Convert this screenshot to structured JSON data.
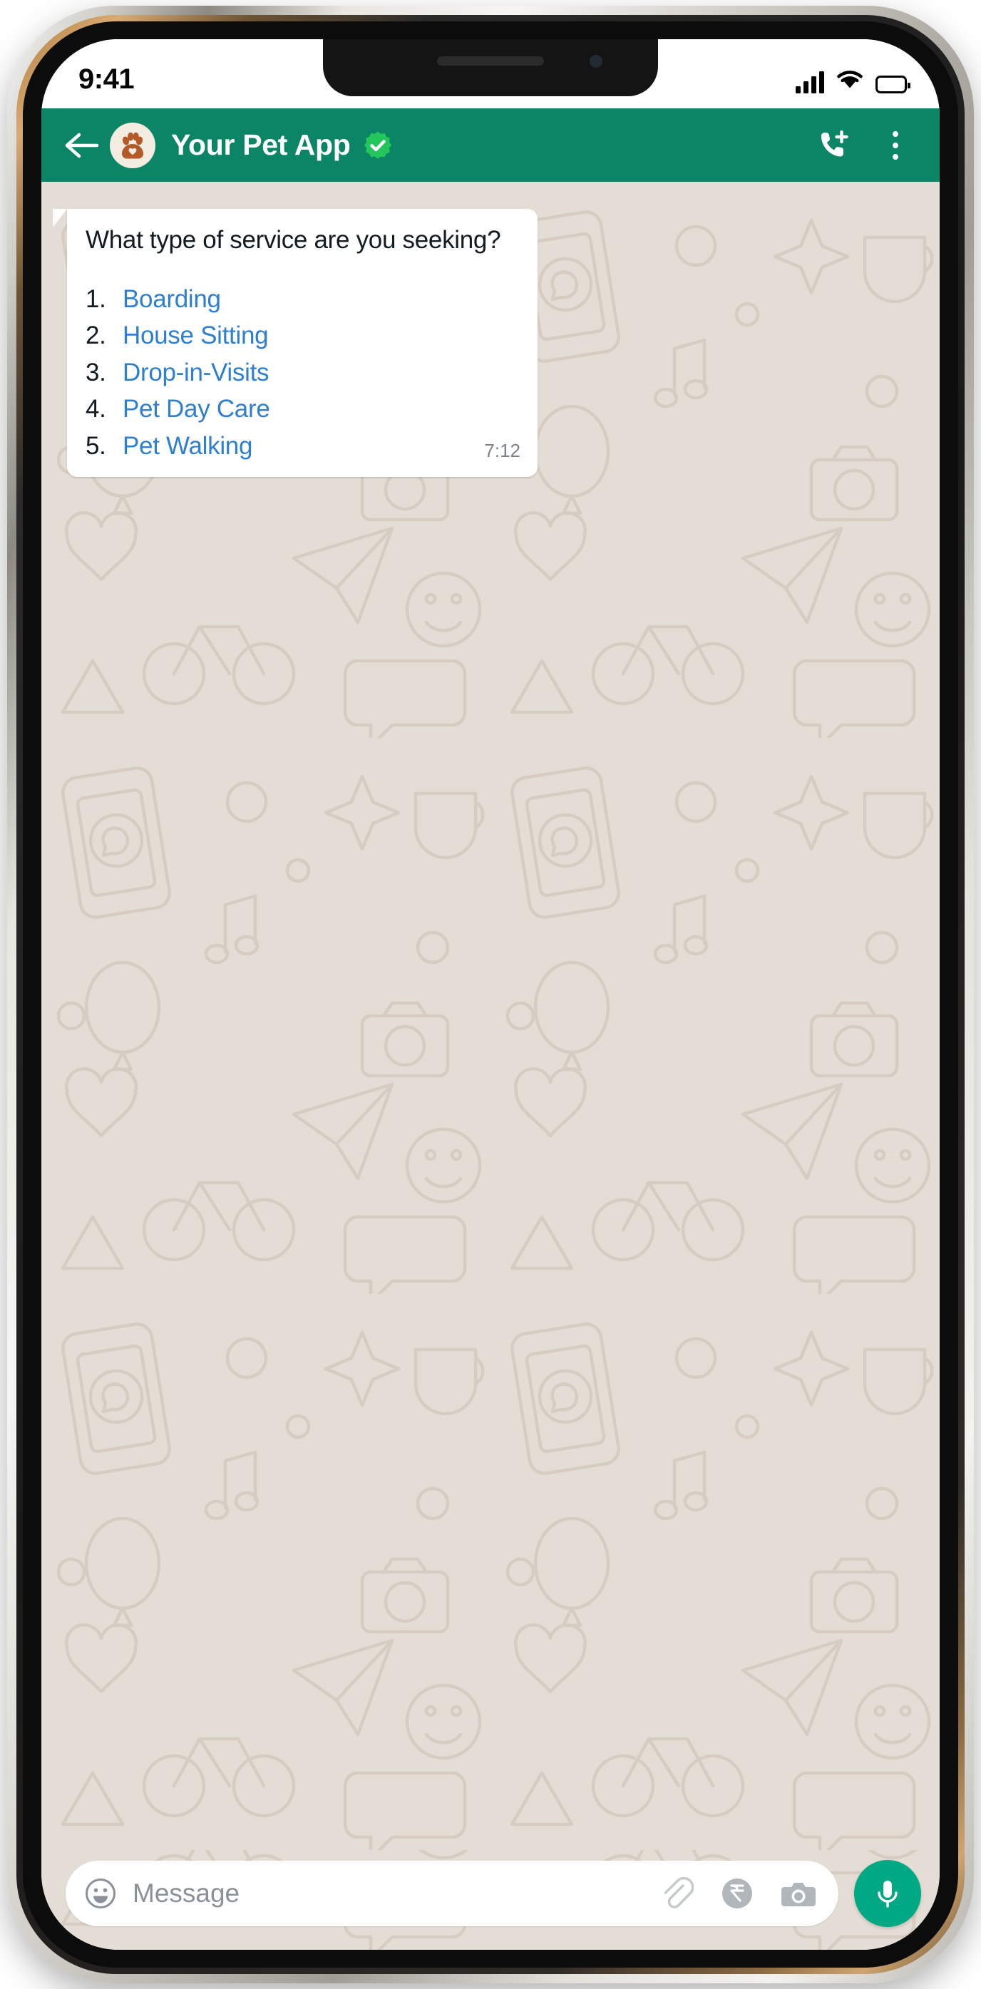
{
  "status_bar": {
    "time": "9:41",
    "signal_icon": "cellular-signal-icon",
    "wifi_icon": "wifi-icon",
    "battery_icon": "battery-full-icon"
  },
  "header": {
    "back_icon": "back-arrow-icon",
    "avatar_icon": "paw-print-avatar-icon",
    "contact_name": "Your Pet App",
    "verified_icon": "verified-check-badge-icon",
    "call_icon": "add-call-icon",
    "menu_icon": "overflow-menu-icon",
    "background_color": "#0c8567"
  },
  "chat": {
    "wallpaper_color": "#e4ddd5",
    "message": {
      "question": "What type of service are you seeking?",
      "options": [
        {
          "number": "1.",
          "label": "Boarding"
        },
        {
          "number": "2.",
          "label": "House Sitting"
        },
        {
          "number": "3.",
          "label": "Drop-in-Visits"
        },
        {
          "number": "4.",
          "label": "Pet Day Care"
        },
        {
          "number": "5.",
          "label": "Pet Walking"
        }
      ],
      "time": "7:12",
      "link_color": "#2f7fd1",
      "bubble_color": "#ffffff"
    }
  },
  "input_bar": {
    "emoji_icon": "emoji-smiley-icon",
    "message_placeholder": "Message",
    "message_value": "",
    "attach_icon": "paperclip-icon",
    "payment_icon": "rupee-payment-icon",
    "camera_icon": "camera-icon",
    "mic_icon": "microphone-icon",
    "mic_button_color": "#00a884"
  }
}
